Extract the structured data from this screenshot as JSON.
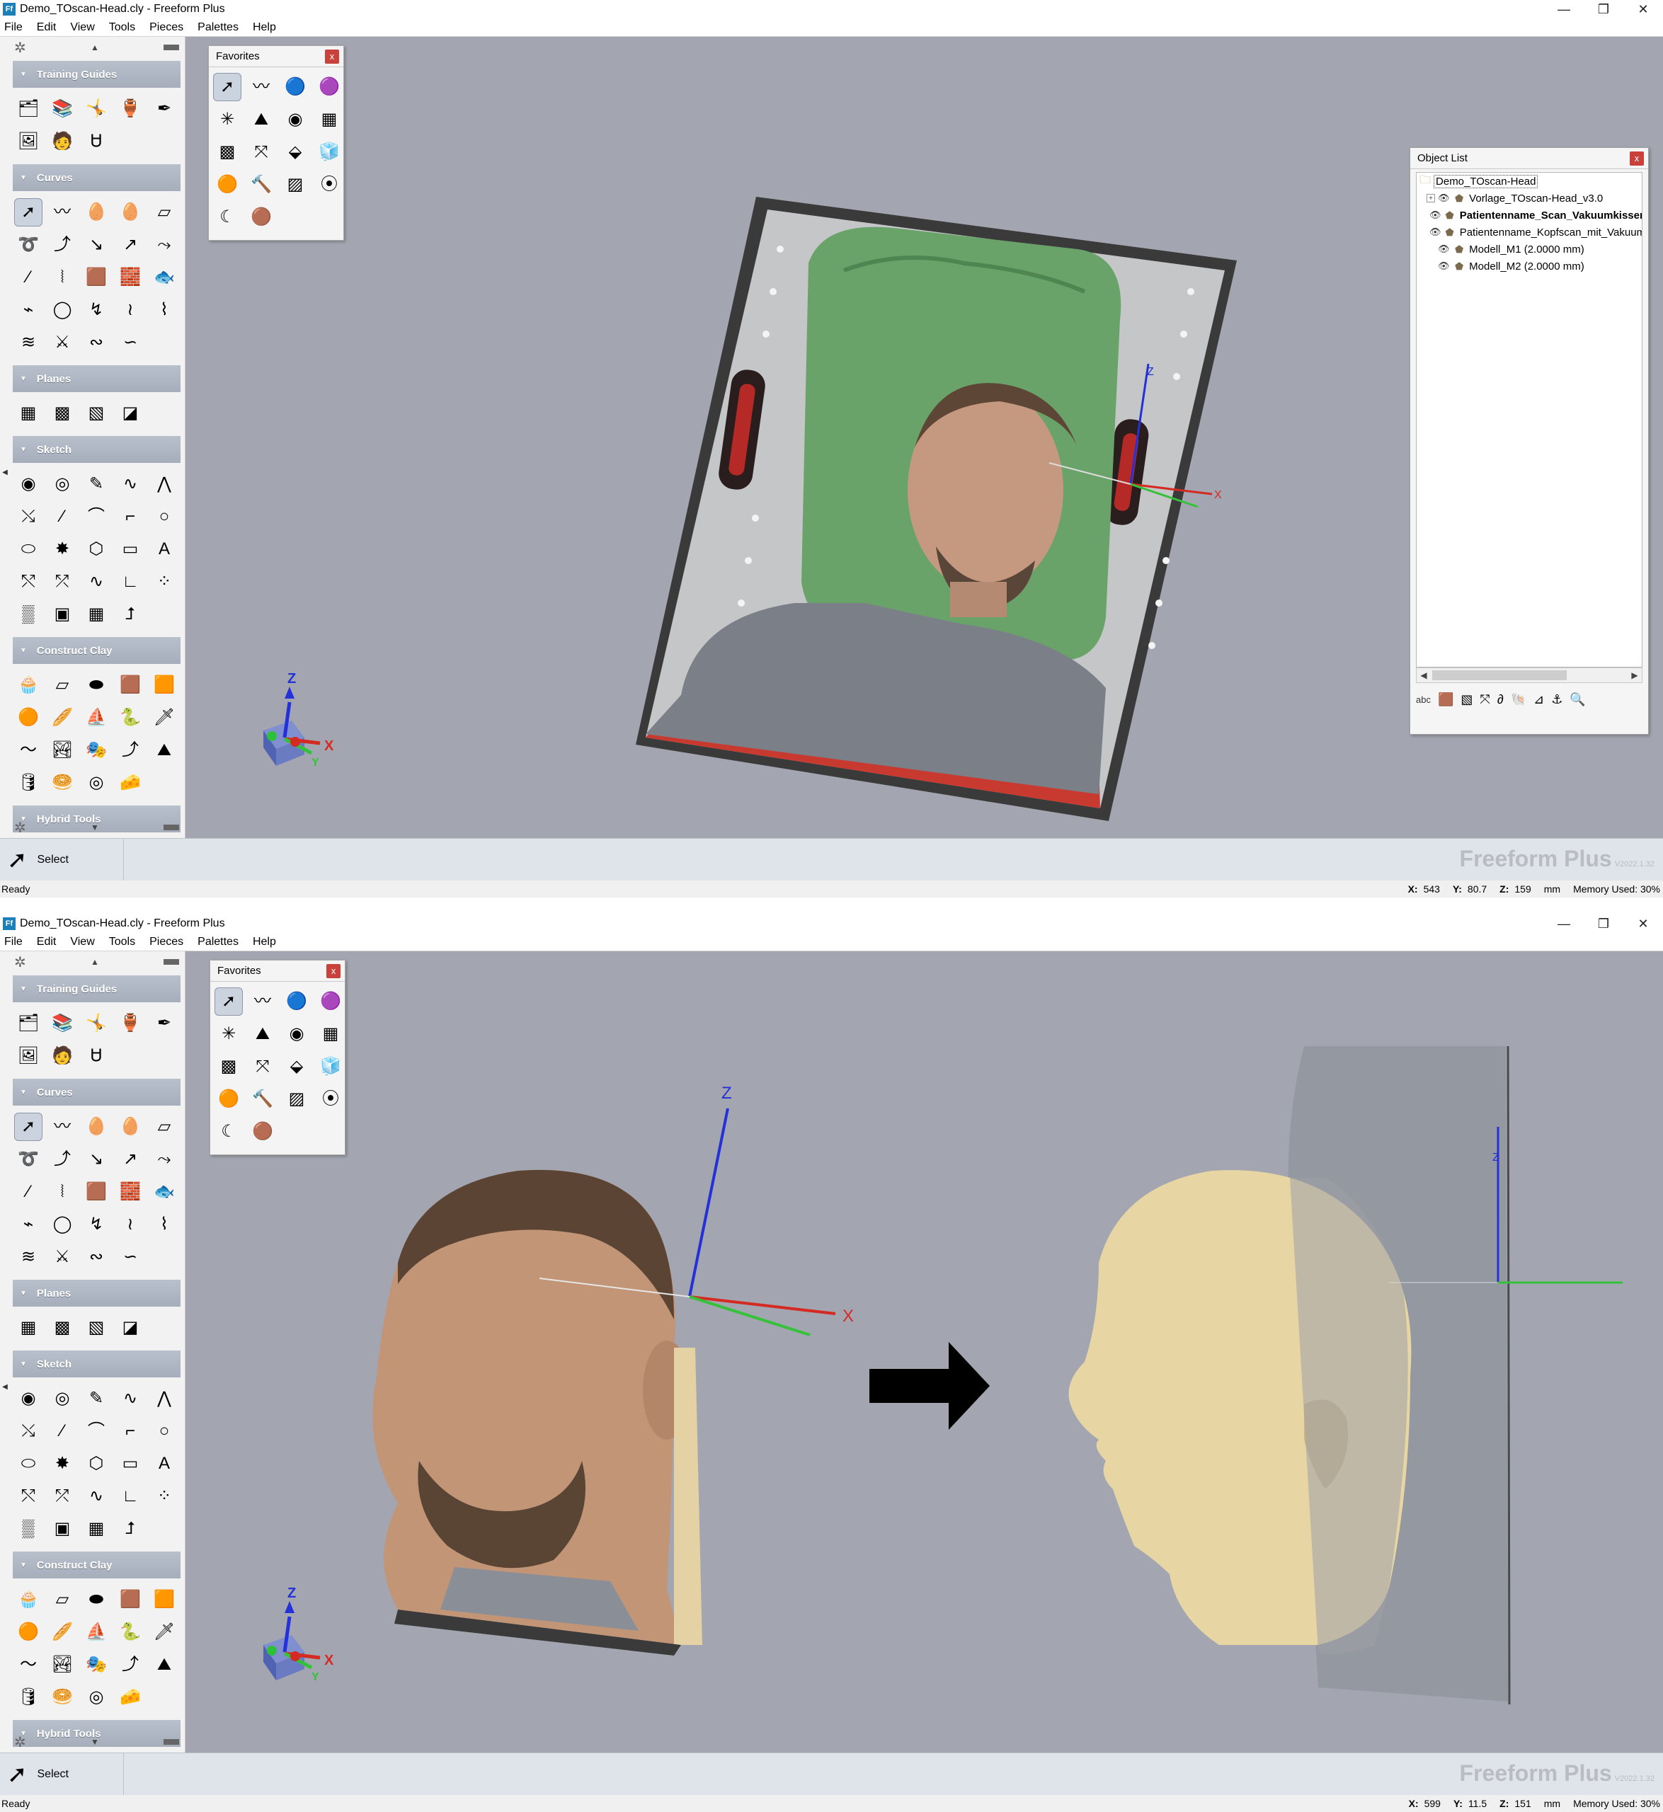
{
  "windows": [
    {
      "title": "Demo_TOscan-Head.cly - Freeform Plus",
      "status": "Ready",
      "coords": {
        "x_label": "X:",
        "x": "543",
        "y_label": "Y:",
        "y": "80.7",
        "z_label": "Z:",
        "z": "159",
        "unit": "mm",
        "memory": "Memory Used: 30%"
      }
    },
    {
      "title": "Demo_TOscan-Head.cly - Freeform Plus",
      "status": "Ready",
      "coords": {
        "x_label": "X:",
        "x": "599",
        "y_label": "Y:",
        "y": "11.5",
        "z_label": "Z:",
        "z": "151",
        "unit": "mm",
        "memory": "Memory Used: 30%"
      }
    }
  ],
  "menu": [
    "File",
    "Edit",
    "View",
    "Tools",
    "Pieces",
    "Palettes",
    "Help"
  ],
  "sidebar": {
    "sections": [
      {
        "label": "Training Guides",
        "tools": [
          "🗂",
          "📚",
          "🤸",
          "🏺",
          "✒",
          "🖼",
          "🧑",
          "Ꮜ"
        ]
      },
      {
        "label": "Curves",
        "tools": [
          "➚",
          "〰",
          "🥚",
          "🥚",
          "▱",
          "➰",
          "⤴",
          "↘",
          "↗",
          "⤳",
          "∕",
          "⦚",
          "🟫",
          "🧱",
          "🐟",
          "⌁",
          "◯",
          "↯",
          "≀",
          "⌇",
          "≋",
          "⚔",
          "∾",
          "∽"
        ]
      },
      {
        "label": "Planes",
        "tools": [
          "▦",
          "▩",
          "▧",
          "◪"
        ]
      },
      {
        "label": "Sketch",
        "tools": [
          "◉",
          "◎",
          "✎",
          "∿",
          "⋀",
          "⤯",
          "∕",
          "⌒",
          "⌐",
          "○",
          "⬭",
          "✸",
          "⬡",
          "▭",
          "A",
          "⤲",
          "⤱",
          "∿",
          "∟",
          "⁘",
          "▒",
          "▣",
          "▦",
          "⮥"
        ]
      },
      {
        "label": "Construct Clay",
        "tools": [
          "🧁",
          "▱",
          "⬬",
          "🟫",
          "🟧",
          "🟠",
          "🥖",
          "⛵",
          "🐍",
          "🗡",
          "〜",
          "🏞",
          "🎭",
          "⤴",
          "⛰",
          "🛢",
          "🥯",
          "◎",
          "🧀"
        ]
      },
      {
        "label": "Hybrid Tools",
        "tools": []
      }
    ]
  },
  "favorites": {
    "title": "Favorites",
    "close": "x",
    "tools": [
      "➚",
      "〰",
      "🔵",
      "🟣",
      "✳",
      "⛰",
      "◉",
      "▦",
      "▩",
      "⤧",
      "⬙",
      "🧊",
      "🟠",
      "🔨",
      "▨",
      "⦿",
      "☾",
      "🟤"
    ]
  },
  "object_list": {
    "title": "Object List",
    "close": "x",
    "root": "Demo_TOscan-Head",
    "items": [
      {
        "label": "Vorlage_TOscan-Head_v3.0",
        "expand": "+",
        "bold": false
      },
      {
        "label": "Patientenname_Scan_Vakuumkissen",
        "expand": "",
        "bold": true
      },
      {
        "label": "Patientenname_Kopfscan_mit_Vakuumkissen",
        "expand": "",
        "bold": false
      },
      {
        "label": "Modell_M1 (2.0000 mm)",
        "expand": "",
        "bold": false
      },
      {
        "label": "Modell_M2 (2.0000 mm)",
        "expand": "",
        "bold": false
      }
    ],
    "toolbar_abc": "abc"
  },
  "command": {
    "label": "Select"
  },
  "brand": {
    "name": "Freeform Plus",
    "version": "V2022.1.32"
  },
  "gizmo": {
    "x": "X",
    "y": "Y",
    "z": "Z"
  },
  "colors": {
    "viewport_bg": "#a3a6b0",
    "section_header": "#aab2be",
    "axis_x": "#d42a22",
    "axis_y": "#35c23a",
    "axis_z": "#2430d8",
    "cushion": "#6aa36a",
    "clay": "#e7d6a4"
  }
}
